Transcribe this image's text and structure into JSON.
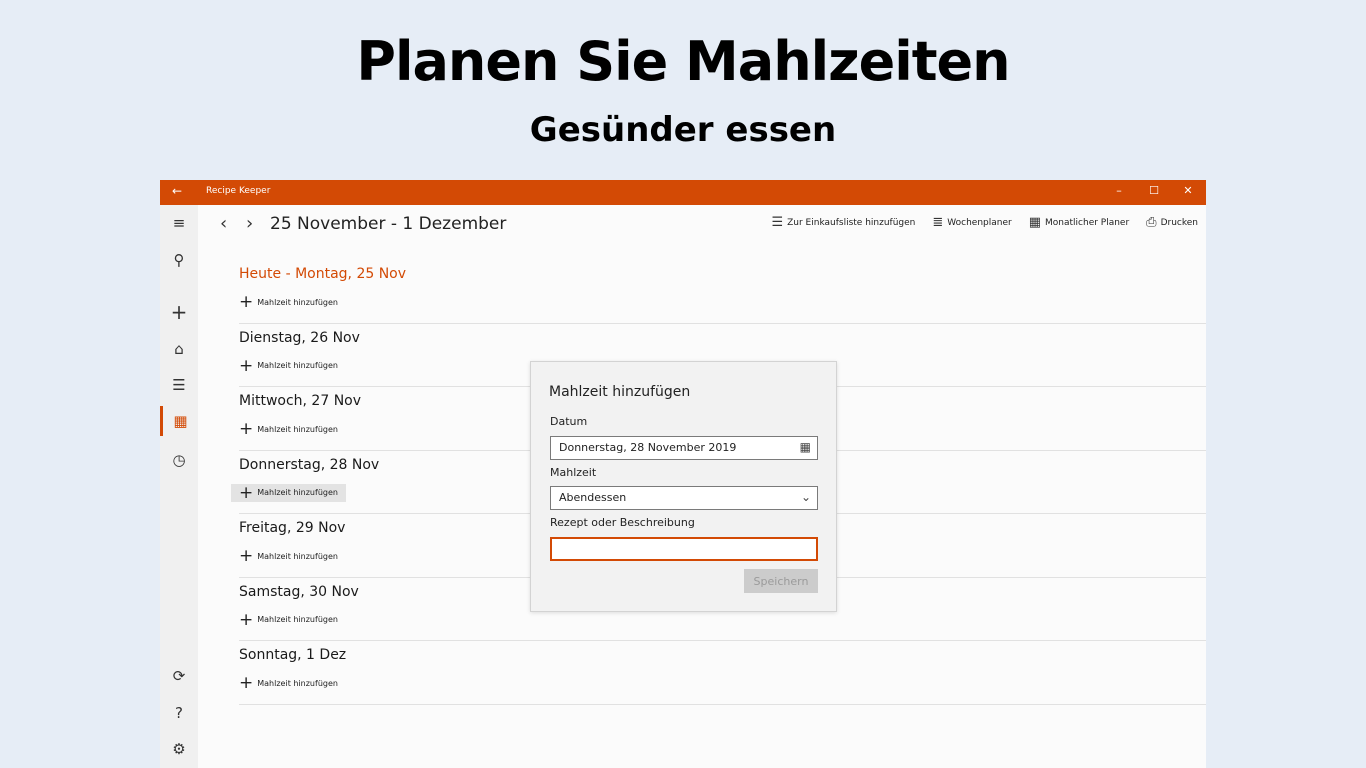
{
  "hero": {
    "title": "Planen Sie Mahlzeiten",
    "subtitle": "Gesünder essen"
  },
  "window": {
    "app_title": "Recipe Keeper",
    "accent": "#d34a05",
    "controls": {
      "back": "←",
      "minimize": "–",
      "maximize": "☐",
      "close": "✕"
    }
  },
  "sidebar": {
    "items": [
      {
        "icon": "hamburger-icon",
        "glyph": "≡"
      },
      {
        "icon": "search-icon",
        "glyph": "⚲"
      },
      {
        "icon": "add-icon",
        "glyph": "+"
      },
      {
        "icon": "home-icon",
        "glyph": "⌂"
      },
      {
        "icon": "shopping-list-icon",
        "glyph": "☰"
      },
      {
        "icon": "calendar-icon",
        "glyph": "▦",
        "active": true
      },
      {
        "icon": "history-icon",
        "glyph": "◷"
      },
      {
        "icon": "sync-icon",
        "glyph": "⟳"
      },
      {
        "icon": "help-icon",
        "glyph": "?"
      },
      {
        "icon": "settings-icon",
        "glyph": "⚙"
      }
    ]
  },
  "planner": {
    "prev": "‹",
    "next": "›",
    "range": "25 November - 1 Dezember",
    "toolbar": {
      "shopping": {
        "icon": "shopping-list-icon",
        "glyph": "☰",
        "label": "Zur Einkaufsliste hinzufügen"
      },
      "weekly": {
        "icon": "weekly-planner-icon",
        "glyph": "≣",
        "label": "Wochenplaner"
      },
      "monthly": {
        "icon": "monthly-planner-icon",
        "glyph": "▦",
        "label": "Monatlicher Planer"
      },
      "print": {
        "icon": "printer-icon",
        "glyph": "⎙",
        "label": "Drucken"
      }
    },
    "add_meal_label": "Mahlzeit hinzufügen",
    "days": [
      {
        "name": "Heute - Montag, 25 Nov",
        "today": true
      },
      {
        "name": "Dienstag, 26 Nov"
      },
      {
        "name": "Mittwoch, 27 Nov"
      },
      {
        "name": "Donnerstag, 28 Nov",
        "hover": true
      },
      {
        "name": "Freitag, 29 Nov"
      },
      {
        "name": "Samstag, 30 Nov"
      },
      {
        "name": "Sonntag, 1 Dez"
      }
    ]
  },
  "dialog": {
    "title": "Mahlzeit hinzufügen",
    "date_label": "Datum",
    "date_value": "Donnerstag, 28 November 2019",
    "meal_label": "Mahlzeit",
    "meal_value": "Abendessen",
    "recipe_label": "Rezept oder Beschreibung",
    "recipe_value": "",
    "save_label": "Speichern"
  }
}
